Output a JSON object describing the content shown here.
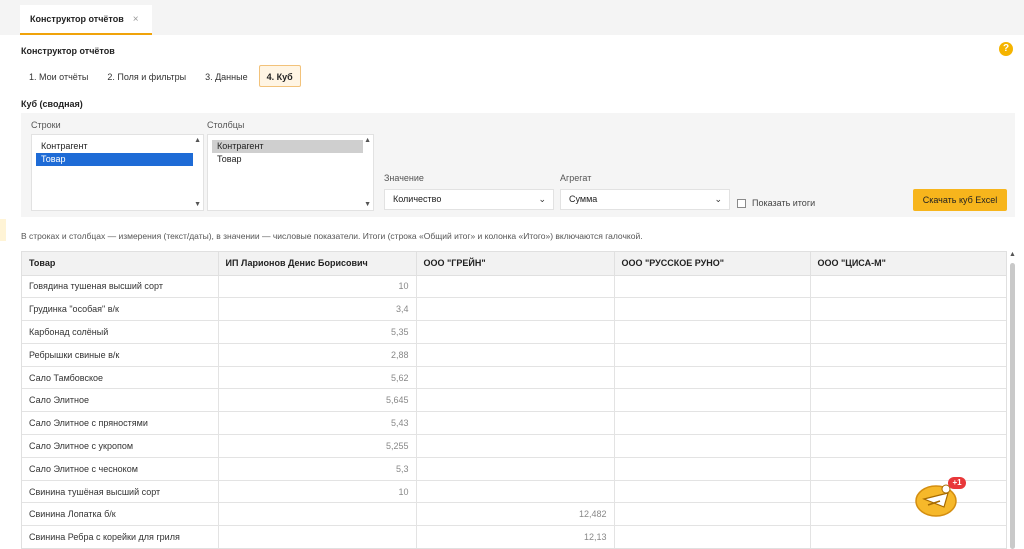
{
  "tab": {
    "title": "Конструктор отчётов",
    "close": "×"
  },
  "page": {
    "title": "Конструктор отчётов",
    "help": "?"
  },
  "steps": [
    {
      "label": "1. Мои отчёты",
      "active": false
    },
    {
      "label": "2. Поля и фильтры",
      "active": false
    },
    {
      "label": "3. Данные",
      "active": false
    },
    {
      "label": "4. Куб",
      "active": true
    }
  ],
  "cube": {
    "title": "Куб (сводная)",
    "rows_label": "Строки",
    "rows_items": [
      "Контрагент",
      "Товар"
    ],
    "rows_selected": "Товар",
    "cols_label": "Столбцы",
    "cols_items": [
      "Контрагент",
      "Товар"
    ],
    "cols_selected": "Контрагент",
    "value_label": "Значение",
    "value_selected": "Количество",
    "aggregate_label": "Агрегат",
    "aggregate_selected": "Сумма",
    "show_totals_label": "Показать итоги",
    "show_totals_checked": false,
    "excel_button": "Скачать куб Excel"
  },
  "hint": "В строках и столбцах — измерения (текст/даты), в значении — числовые показатели. Итоги (строка «Общий итог» и колонка «Итого») включаются галочкой.",
  "table": {
    "headers": [
      "Товар",
      "ИП Ларионов Денис Борисович",
      "ООО \"ГРЕЙН\"",
      "ООО \"РУССКОЕ РУНО\"",
      "ООО \"ЦИСА-М\""
    ],
    "rows": [
      [
        "Говядина тушеная высший сорт",
        "10",
        "",
        "",
        ""
      ],
      [
        "Грудинка \"особая\" в/к",
        "3,4",
        "",
        "",
        ""
      ],
      [
        "Карбонад солёный",
        "5,35",
        "",
        "",
        ""
      ],
      [
        "Ребрышки свиные в/к",
        "2,88",
        "",
        "",
        ""
      ],
      [
        "Сало Тамбовское",
        "5,62",
        "",
        "",
        ""
      ],
      [
        "Сало Элитное",
        "5,645",
        "",
        "",
        ""
      ],
      [
        "Сало Элитное с пряностями",
        "5,43",
        "",
        "",
        ""
      ],
      [
        "Сало Элитное с укропом",
        "5,255",
        "",
        "",
        ""
      ],
      [
        "Сало Элитное с чесноком",
        "5,3",
        "",
        "",
        ""
      ],
      [
        "Свинина тушёная высший сорт",
        "10",
        "",
        "",
        ""
      ],
      [
        "Свинина Лопатка б/к",
        "",
        "12,482",
        "",
        ""
      ],
      [
        "Свинина Ребра с корейки для гриля",
        "",
        "12,13",
        "",
        ""
      ],
      [
        "",
        "",
        "",
        "",
        ""
      ]
    ]
  },
  "fab": {
    "badge": "+1"
  },
  "icons": {
    "close": "close-icon",
    "help": "help-icon",
    "chevron": "chevron-down-icon",
    "chat": "chat-bot-icon"
  }
}
